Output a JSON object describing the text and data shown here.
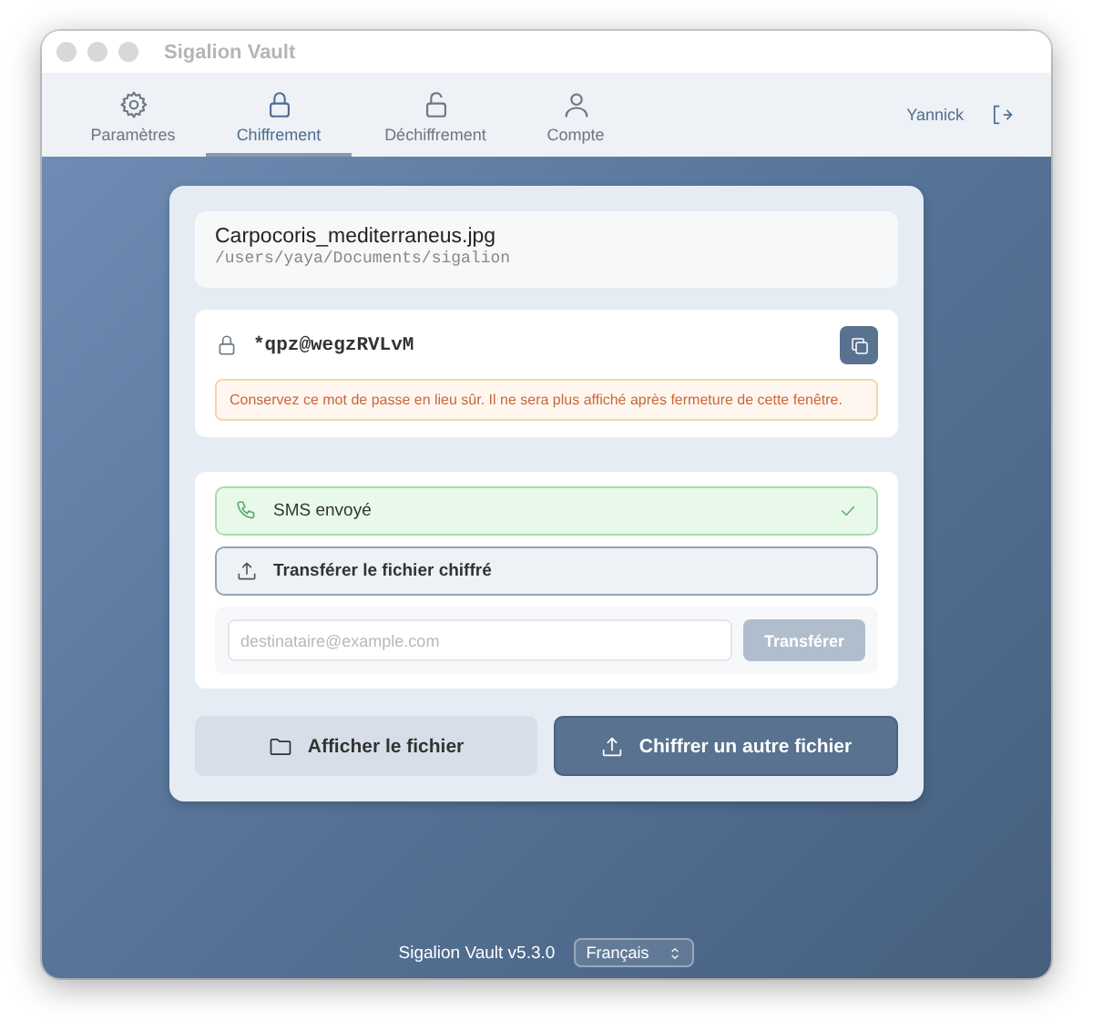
{
  "window": {
    "title": "Sigalion Vault"
  },
  "tabs": [
    {
      "label": "Paramètres",
      "selected": false
    },
    {
      "label": "Chiffrement",
      "selected": true
    },
    {
      "label": "Déchiffrement",
      "selected": false
    },
    {
      "label": "Compte",
      "selected": false
    }
  ],
  "user": {
    "name": "Yannick"
  },
  "file": {
    "name": "Carpocoris_mediterraneus.jpg",
    "path": "/users/yaya/Documents/sigalion"
  },
  "password": {
    "value": "*qpz@wegzRVLvM",
    "warning": "Conservez ce mot de passe en lieu sûr. Il ne sera plus affiché après fermeture de cette fenêtre."
  },
  "sms": {
    "label": "SMS envoyé",
    "done": true
  },
  "transfer": {
    "label": "Transférer le fichier chiffré",
    "expanded": true,
    "placeholder": "destinataire@example.com",
    "button": {
      "label": "Transférer",
      "disabled": true
    }
  },
  "actions": [
    {
      "label": "Afficher le fichier",
      "kind": "secondary"
    },
    {
      "label": "Chiffrer un autre fichier",
      "kind": "primary"
    }
  ],
  "footer": {
    "version": "Sigalion Vault v5.3.0",
    "language": "Français"
  }
}
